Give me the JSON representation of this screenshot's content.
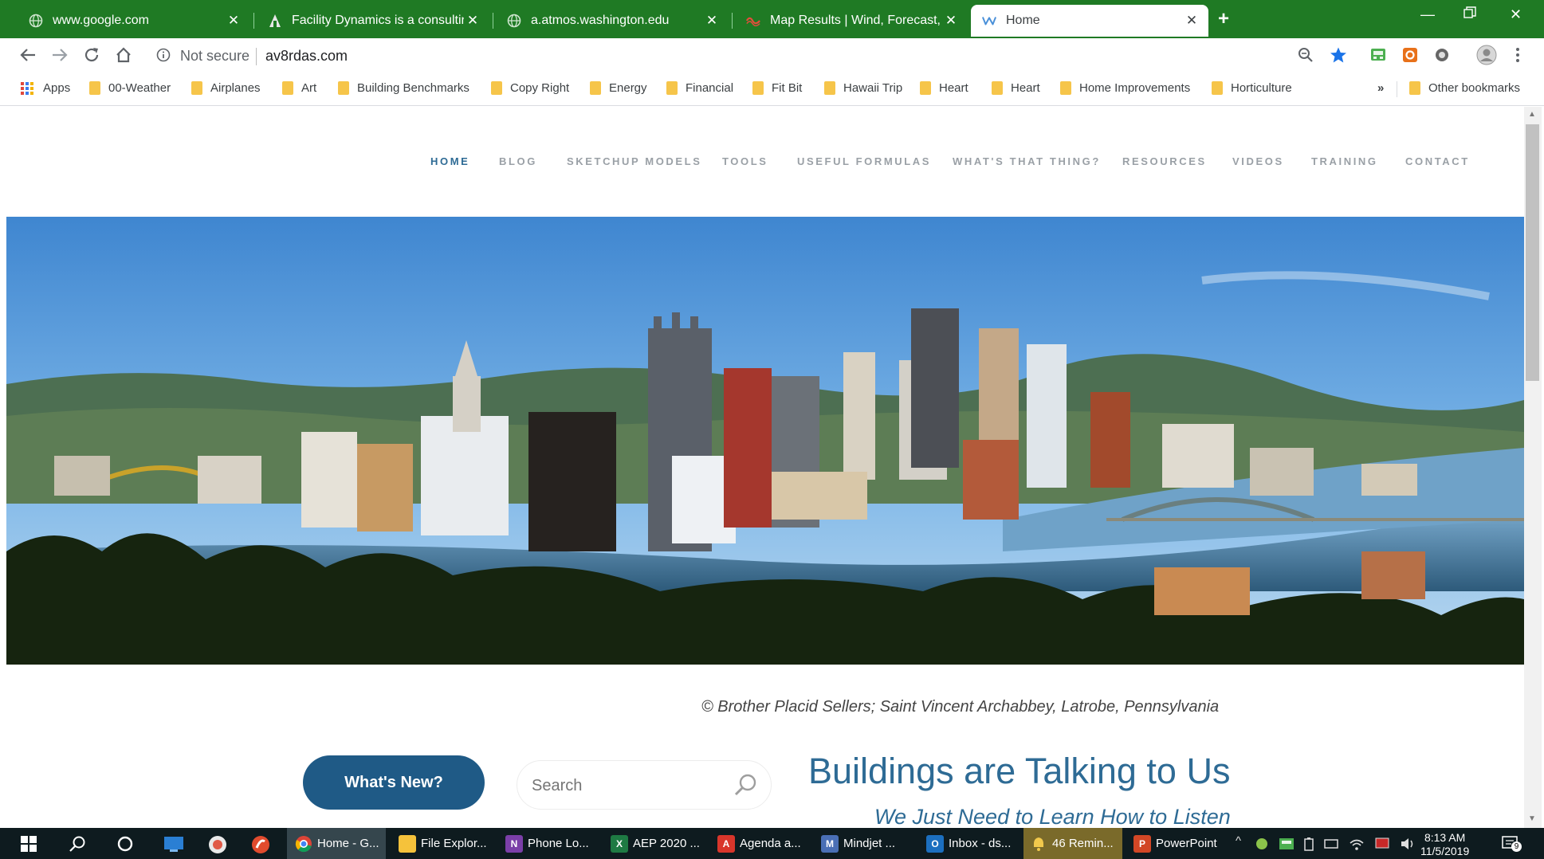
{
  "browser": {
    "tabs": [
      {
        "title": "www.google.com",
        "favicon": "globe-icon"
      },
      {
        "title": "Facility Dynamics is a consulting",
        "favicon": "facility-dynamics-icon"
      },
      {
        "title": "a.atmos.washington.edu",
        "favicon": "globe-icon"
      },
      {
        "title": "Map Results | Wind, Forecast, Ra",
        "favicon": "map-icon"
      },
      {
        "title": "Home",
        "favicon": "wordpress-icon",
        "active": true
      }
    ],
    "address": {
      "security": "Not secure",
      "url": "av8rdas.com"
    },
    "bookmarks": [
      "Apps",
      "00-Weather",
      "Airplanes",
      "Art",
      "Building Benchmarks",
      "Copy Right",
      "Energy",
      "Financial",
      "Fit Bit",
      "Hawaii Trip",
      "Heart",
      "Heart",
      "Home Improvements",
      "Horticulture"
    ],
    "bookmarks_overflow": "»",
    "other_bookmarks": "Other bookmarks"
  },
  "site": {
    "nav": [
      "HOME",
      "BLOG",
      "SKETCHUP MODELS",
      "TOOLS",
      "USEFUL FORMULAS",
      "WHAT'S THAT THING?",
      "RESOURCES",
      "VIDEOS",
      "TRAINING",
      "CONTACT"
    ],
    "active_nav": "HOME",
    "caption": "© Brother Placid Sellers;  Saint Vincent Archabbey, Latrobe, Pennsylvania",
    "whats_new": "What's New?",
    "search_placeholder": "Search",
    "headline": "Buildings are Talking to Us",
    "subheadline": "We Just Need to Learn How to Listen",
    "accent_color": "#2e6b95",
    "button_color": "#1f5a86"
  },
  "taskbar": {
    "items": [
      {
        "label": "Home - G...",
        "icon": "chrome-icon",
        "active": true
      },
      {
        "label": "File Explor...",
        "icon": "folder-icon"
      },
      {
        "label": "Phone Lo...",
        "icon": "onenote-icon"
      },
      {
        "label": "AEP 2020 ...",
        "icon": "excel-icon"
      },
      {
        "label": "Agenda a...",
        "icon": "pdf-icon"
      },
      {
        "label": "Mindjet ...",
        "icon": "mindjet-icon"
      },
      {
        "label": "Inbox - ds...",
        "icon": "outlook-icon"
      },
      {
        "label": "46 Remin...",
        "icon": "bell-icon",
        "highlight": true
      },
      {
        "label": "PowerPoint",
        "icon": "powerpoint-icon"
      }
    ],
    "time": "8:13 AM",
    "date": "11/5/2019",
    "notification_count": "9"
  }
}
